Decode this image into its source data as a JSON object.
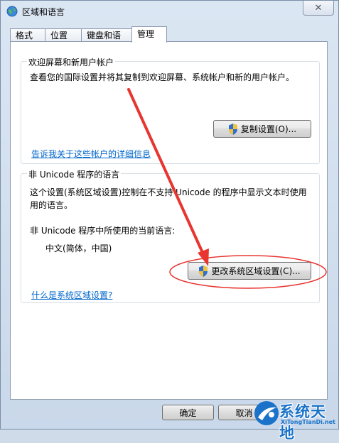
{
  "window": {
    "title": "区域和语言",
    "close_glyph": "✕"
  },
  "tabs": [
    {
      "label": "格式"
    },
    {
      "label": "位置"
    },
    {
      "label": "键盘和语言"
    },
    {
      "label": "管理",
      "active": true
    }
  ],
  "welcome_group": {
    "title": "欢迎屏幕和新用户帐户",
    "description": "查看您的国际设置并将其复制到欢迎屏幕、系统帐户和新的用户帐户。",
    "copy_button": "复制设置(O)...",
    "link": "告诉我关于这些帐户的详细信息"
  },
  "unicode_group": {
    "title": "非 Unicode 程序的语言",
    "description_line1": "这个设置(系统区域设置)控制在不支持 Unicode 的程序中显示文本时使用",
    "description_line2": "用的语言。",
    "current_label": "非 Unicode 程序中所使用的当前语言:",
    "current_value": "中文(简体，中国)",
    "change_button": "更改系统区域设置(C)...",
    "link": "什么是系统区域设置?"
  },
  "footer": {
    "ok_button": "确定",
    "cancel_button": "取消"
  },
  "annotation": {
    "arrow_color": "#e8352f",
    "highlight_color": "#e8352f"
  },
  "watermark": {
    "name": "系统天地",
    "url": "XiTongTianDi.net",
    "color": "#1a73c8"
  }
}
